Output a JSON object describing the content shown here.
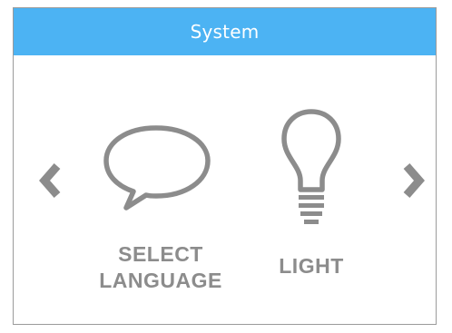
{
  "window": {
    "title": "System"
  },
  "colors": {
    "titlebar": "#4cb3f3",
    "icon_gray": "#8c8c8c",
    "border": "#9b9b9b"
  },
  "navigation": {
    "prev_icon": "chevron-left-icon",
    "next_icon": "chevron-right-icon"
  },
  "menu": {
    "items": [
      {
        "label_line1": "SELECT",
        "label_line2": "LANGUAGE",
        "icon": "speech-bubble-icon"
      },
      {
        "label_line1": "LIGHT",
        "icon": "lightbulb-icon"
      }
    ]
  }
}
